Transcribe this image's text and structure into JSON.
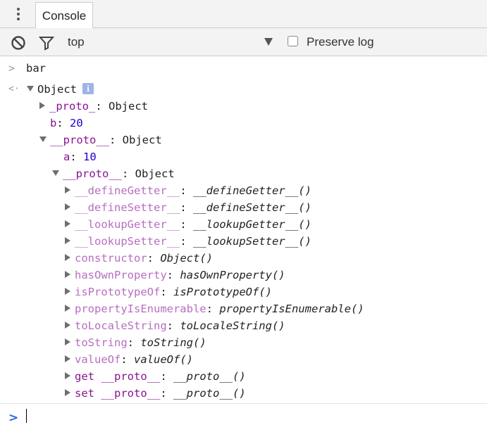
{
  "tab": {
    "label": "Console"
  },
  "toolbar": {
    "context": "top",
    "preserve_log_label": "Preserve log",
    "preserve_log_checked": false,
    "icons": [
      "clear-icon",
      "filter-icon",
      "chevron-down-icon"
    ]
  },
  "console": {
    "input_command": "bar",
    "result_label": "Object",
    "info_glyph": "i",
    "tree": {
      "proto_single": {
        "key": "_proto_",
        "sep": ": ",
        "value": "Object"
      },
      "b": {
        "key": "b",
        "sep": ": ",
        "value": "20"
      },
      "proto1": {
        "key": "__proto__",
        "sep": ": ",
        "value": "Object"
      },
      "a": {
        "key": "a",
        "sep": ": ",
        "value": "10"
      },
      "proto2": {
        "key": "__proto__",
        "sep": ": ",
        "value": "Object"
      },
      "members": [
        {
          "key": "__defineGetter__",
          "sep": ": ",
          "value": "__defineGetter__()"
        },
        {
          "key": "__defineSetter__",
          "sep": ": ",
          "value": "__defineSetter__()"
        },
        {
          "key": "__lookupGetter__",
          "sep": ": ",
          "value": "__lookupGetter__()"
        },
        {
          "key": "__lookupSetter__",
          "sep": ": ",
          "value": "__lookupSetter__()"
        },
        {
          "key": "constructor",
          "sep": ": ",
          "value": "Object()"
        },
        {
          "key": "hasOwnProperty",
          "sep": ": ",
          "value": "hasOwnProperty()"
        },
        {
          "key": "isPrototypeOf",
          "sep": ": ",
          "value": "isPrototypeOf()"
        },
        {
          "key": "propertyIsEnumerable",
          "sep": ": ",
          "value": "propertyIsEnumerable()"
        },
        {
          "key": "toLocaleString",
          "sep": ": ",
          "value": "toLocaleString()"
        },
        {
          "key": "toString",
          "sep": ": ",
          "value": "toString()"
        },
        {
          "key": "valueOf",
          "sep": ": ",
          "value": "valueOf()"
        },
        {
          "key": "get __proto__",
          "sep": ": ",
          "value": "__proto__()"
        },
        {
          "key": "set __proto__",
          "sep": ": ",
          "value": "__proto__()"
        }
      ]
    },
    "prompt_value": ""
  },
  "colors": {
    "own_property": "#881391",
    "inherited_property": "#b86ec1",
    "number": "#1c00cf",
    "prompt": "#2a6bd8"
  }
}
